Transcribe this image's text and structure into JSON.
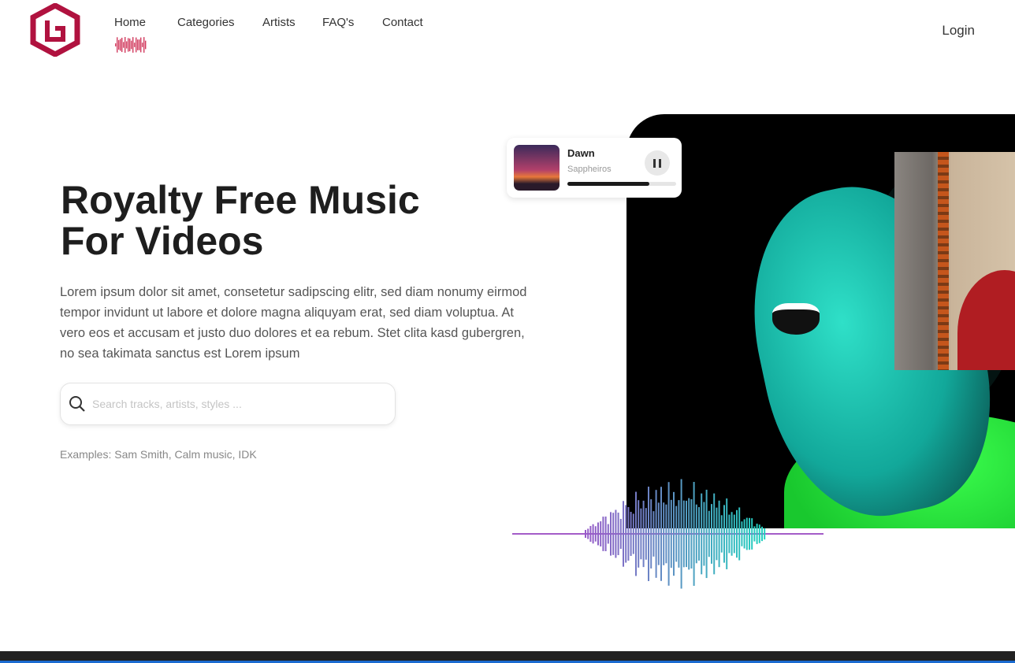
{
  "header": {
    "nav": [
      {
        "label": "Home",
        "active": true
      },
      {
        "label": "Categories"
      },
      {
        "label": "Artists"
      },
      {
        "label": "FAQ's"
      },
      {
        "label": "Contact"
      }
    ],
    "login_label": "Login",
    "brand_color": "#b0123f"
  },
  "hero": {
    "title_line1": "Royalty Free Music",
    "title_line2": "For Videos",
    "description": "Lorem ipsum dolor sit amet, consetetur sadipscing elitr, sed diam nonumy eirmod tempor invidunt ut labore et dolore magna aliquyam erat, sed diam voluptua. At vero eos et accusam et justo duo dolores et ea rebum. Stet clita kasd gubergren, no sea takimata sanctus est Lorem ipsum",
    "search_placeholder": "Search tracks, artists, styles ...",
    "examples": "Examples: Sam Smith, Calm music, IDK"
  },
  "player": {
    "track_title": "Dawn",
    "artist": "Sappheiros",
    "progress": 0.75,
    "state": "playing"
  }
}
